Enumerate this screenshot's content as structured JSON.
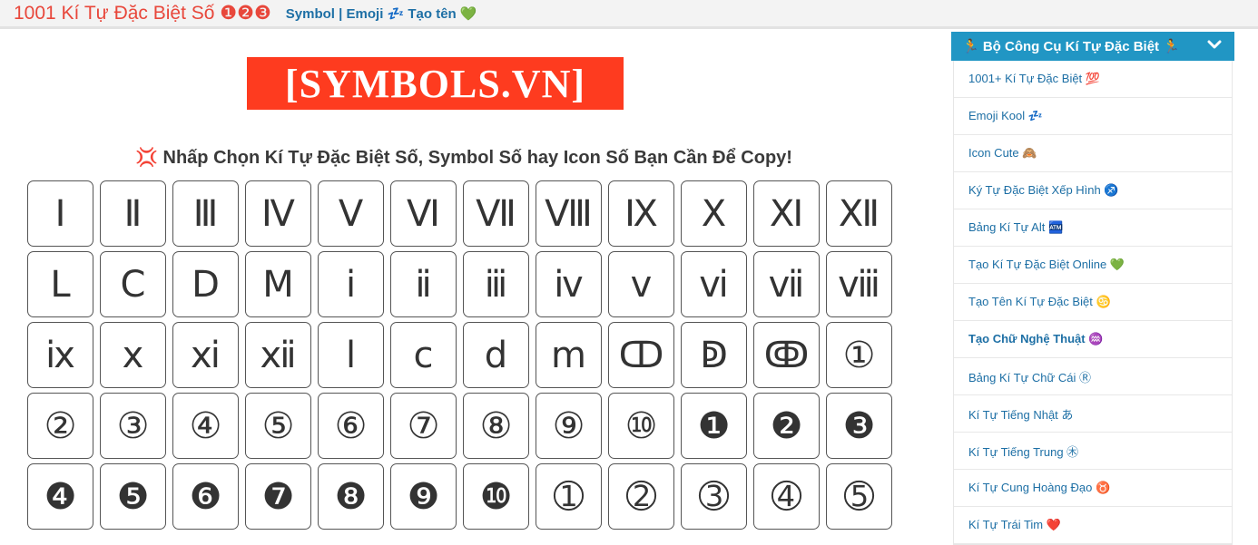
{
  "header": {
    "site_title": "1001 Kí Tự Đặc Biệt Số ❶❷❸",
    "links": [
      "Symbol",
      "Emoji 💤",
      "Tạo tên 💚"
    ],
    "separator": "|"
  },
  "main": {
    "logo_text": "[SYMBOLS.VN]",
    "instruction": "💢 Nhấp Chọn Kí Tự Đặc Biệt Số, Symbol Số hay Icon Số Bạn Cần Để Copy!",
    "symbols": [
      "Ⅰ",
      "Ⅱ",
      "Ⅲ",
      "Ⅳ",
      "Ⅴ",
      "Ⅵ",
      "Ⅶ",
      "Ⅷ",
      "Ⅸ",
      "Ⅹ",
      "Ⅺ",
      "Ⅻ",
      "Ⅼ",
      "Ⅽ",
      "Ⅾ",
      "Ⅿ",
      "ⅰ",
      "ⅱ",
      "ⅲ",
      "ⅳ",
      "ⅴ",
      "ⅵ",
      "ⅶ",
      "ⅷ",
      "ⅸ",
      "ⅹ",
      "ⅺ",
      "ⅻ",
      "ⅼ",
      "ⅽ",
      "ⅾ",
      "ⅿ",
      "ↀ",
      "ↁ",
      "ↂ",
      "①",
      "②",
      "③",
      "④",
      "⑤",
      "⑥",
      "⑦",
      "⑧",
      "⑨",
      "⑩",
      "❶",
      "❷",
      "❸",
      "❹",
      "❺",
      "❻",
      "❼",
      "❽",
      "❾",
      "❿",
      "➀",
      "➁",
      "➂",
      "➃",
      "➄"
    ]
  },
  "sidebar": {
    "title": "🏃 Bộ Công Cụ Kí Tự Đặc Biệt 🏃",
    "collapse_icon": "chevron-down-icon",
    "items": [
      {
        "label": "1001+ Kí Tự Đặc Biệt 💯",
        "bold": false
      },
      {
        "label": "Emoji Kool 💤",
        "bold": false
      },
      {
        "label": "Icon Cute 🙈",
        "bold": false
      },
      {
        "label": "Ký Tự Đặc Biệt Xếp Hình ♐",
        "bold": false
      },
      {
        "label": "Bảng Kí Tự Alt 🏧",
        "bold": false
      },
      {
        "label": "Tạo Kí Tự Đặc Biệt Online 💚",
        "bold": false
      },
      {
        "label": "Tạo Tên Kí Tự Đặc Biệt ♋",
        "bold": false
      },
      {
        "label": "Tạo Chữ Nghệ Thuật ♒",
        "bold": true
      },
      {
        "label": "Bảng Kí Tự Chữ Cái Ⓡ",
        "bold": false
      },
      {
        "label": "Kí Tự Tiếng Nhật あ",
        "bold": false
      },
      {
        "label": "Kí Tự Tiếng Trung ㊍",
        "bold": false
      },
      {
        "label": "Kí Tự Cung Hoàng Đạo ♉",
        "bold": false
      },
      {
        "label": "Kí Tự Trái Tim ❤️",
        "bold": false
      }
    ]
  },
  "colors": {
    "title_red": "#e8473b",
    "link_blue": "#1d6fa5",
    "banner_red": "#fe3b1f",
    "sidebar_header": "#2196c4"
  }
}
